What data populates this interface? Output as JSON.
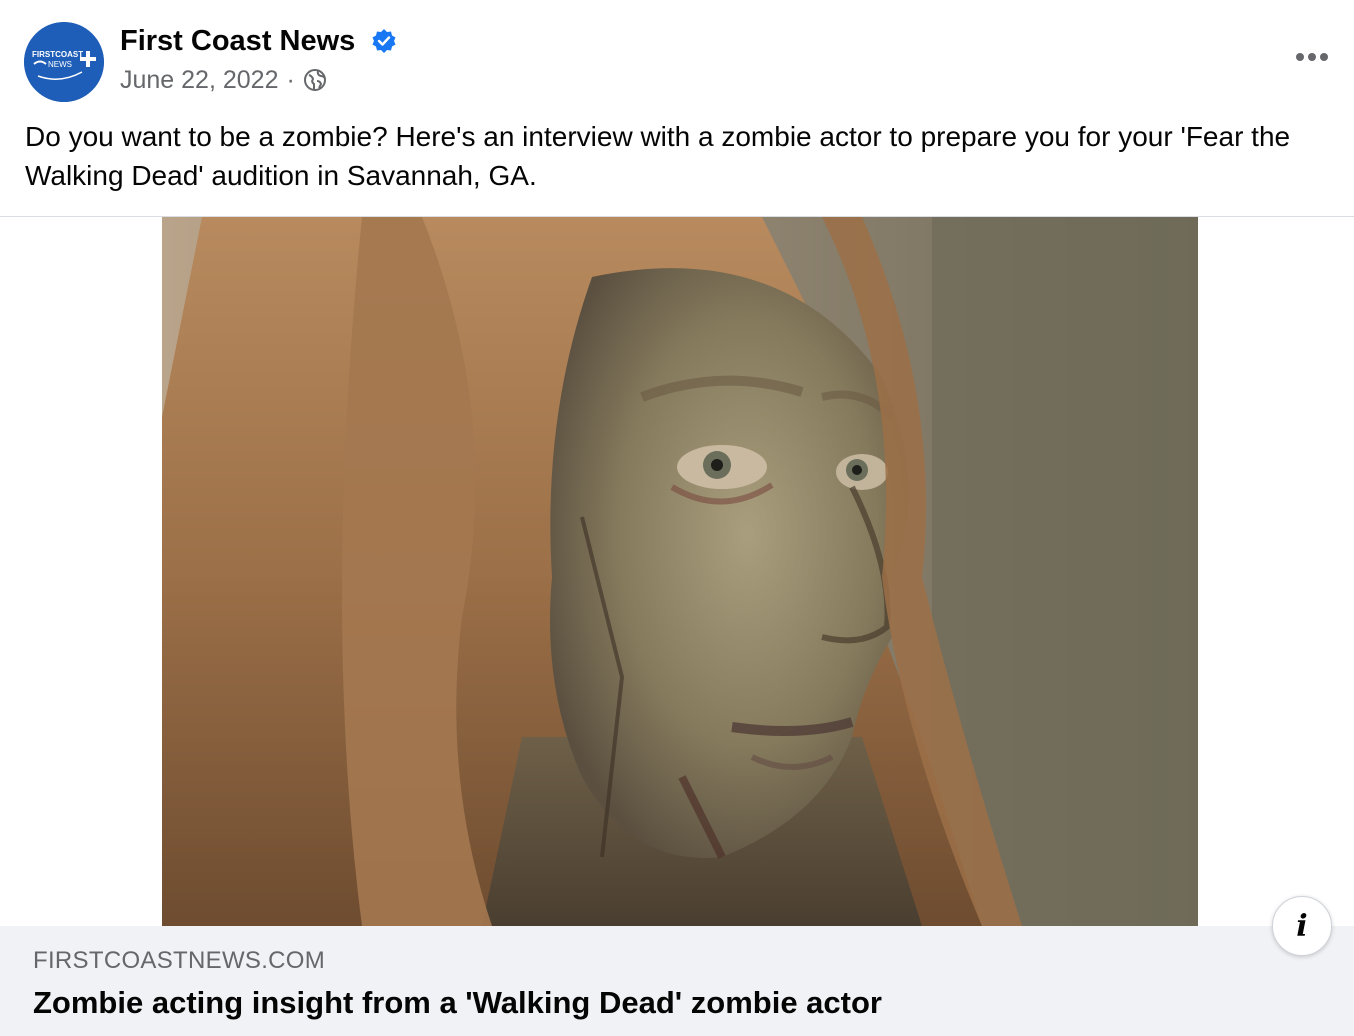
{
  "post": {
    "page_name": "First Coast News",
    "date": "June 22, 2022",
    "separator": "·",
    "caption": "Do you want to be a zombie? Here's an interview with a zombie actor to prepare you for your 'Fear the Walking Dead' audition in Savannah, GA.",
    "avatar_logo_lines": [
      "FIRSTCOAST",
      "NEWS"
    ],
    "icons": {
      "verified": "verified-badge-icon",
      "audience": "globe-icon",
      "more": "more-options-icon",
      "info": "info-icon"
    }
  },
  "link_preview": {
    "domain": "FIRSTCOASTNEWS.COM",
    "title": "Zombie acting insight from a 'Walking Dead' zombie actor",
    "info_label": "i"
  },
  "colors": {
    "brand_blue": "#1f5eb8",
    "verified_blue": "#1877f2",
    "secondary_text": "#65676b",
    "footer_bg": "#f0f2f5"
  }
}
